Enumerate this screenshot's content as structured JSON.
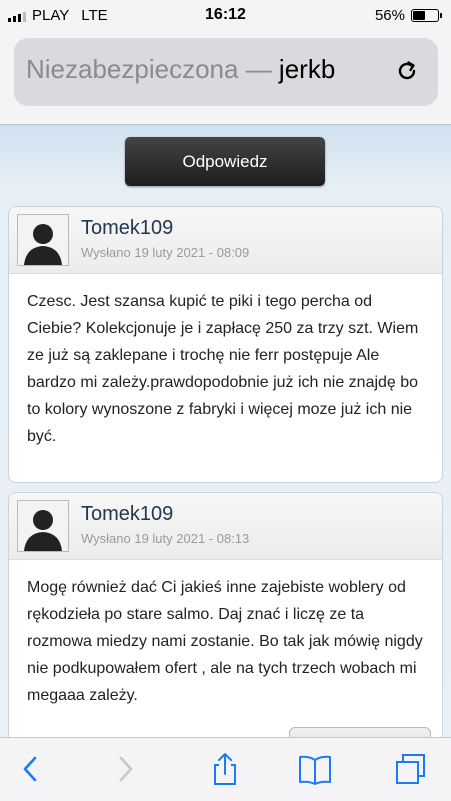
{
  "status_bar": {
    "carrier": "PLAY",
    "network": "LTE",
    "time": "16:12",
    "battery_percent": "56%",
    "battery_level": 0.56
  },
  "url_bar": {
    "prefix": "Niezabezpieczona — ",
    "host": "jerkb"
  },
  "page": {
    "reply_label": "Odpowiedz",
    "posts": [
      {
        "author": "Tomek109",
        "date": "Wysłano 19 luty 2021 - 08:09",
        "body": "Czesc. Jest szansa kupić te piki i tego percha od Ciebie? Kolekcjonuje je i zapłacę 250 za trzy szt. Wiem ze już są zaklepane i trochę nie ferr postępuje Ale bardzo mi zależy.prawdopodobnie już ich nie znajdę bo to kolory wynoszone z fabryki i więcej moze już ich nie być."
      },
      {
        "author": "Tomek109",
        "date": "Wysłano 19 luty 2021 - 08:13",
        "body": "Mogę również dać Ci jakieś inne zajebiste woblery od rękodzieła po stare salmo. Daj znać i liczę ze ta rozmowa miedzy nami zostanie. Bo tak jak mówię nigdy nie podkupowałem ofert , ale na tych trzech wobach mi megaaa zależy."
      }
    ]
  },
  "toolbar": {
    "icons": [
      "back-icon",
      "forward-icon",
      "share-icon",
      "bookmarks-icon",
      "tabs-icon"
    ],
    "accent": "#1a7cf5",
    "disabled": "#c7c7cc"
  }
}
